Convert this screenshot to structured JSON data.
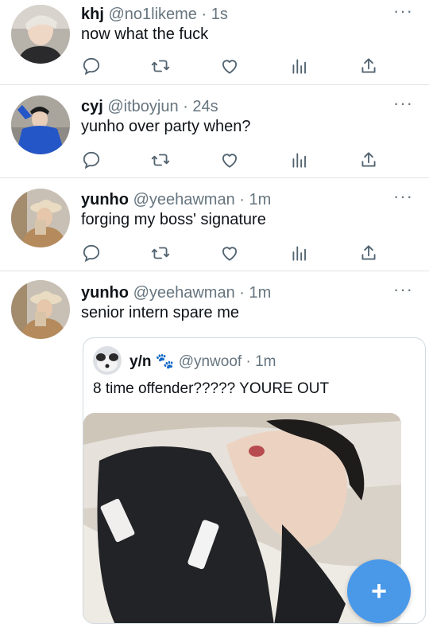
{
  "tweets": [
    {
      "name": "khj",
      "handle": "@no1likeme",
      "dot": "·",
      "time": "1s",
      "text": "now what the fuck",
      "more": "···"
    },
    {
      "name": "cyj",
      "handle": "@itboyjun",
      "dot": "·",
      "time": "24s",
      "text": "yunho over party when?",
      "more": "···"
    },
    {
      "name": "yunho",
      "handle": "@yeehawman",
      "dot": "·",
      "time": "1m",
      "text": "forging my boss' signature",
      "more": "···"
    },
    {
      "name": "yunho",
      "handle": "@yeehawman",
      "dot": "·",
      "time": "1m",
      "text": "senior intern spare me",
      "more": "···"
    }
  ],
  "quote": {
    "name": "y/n",
    "badge": "🐾",
    "handle": "@ynwoof",
    "dot": "·",
    "time": "1m",
    "text": "8 time offender????? YOURE OUT"
  },
  "fab": {
    "label": "+"
  },
  "colors": {
    "accent": "#4a99e9",
    "secondary_text": "#66757f",
    "divider": "#dfe3e6"
  },
  "action_icons": [
    "reply-icon",
    "retweet-icon",
    "like-icon",
    "analytics-icon",
    "share-icon"
  ]
}
